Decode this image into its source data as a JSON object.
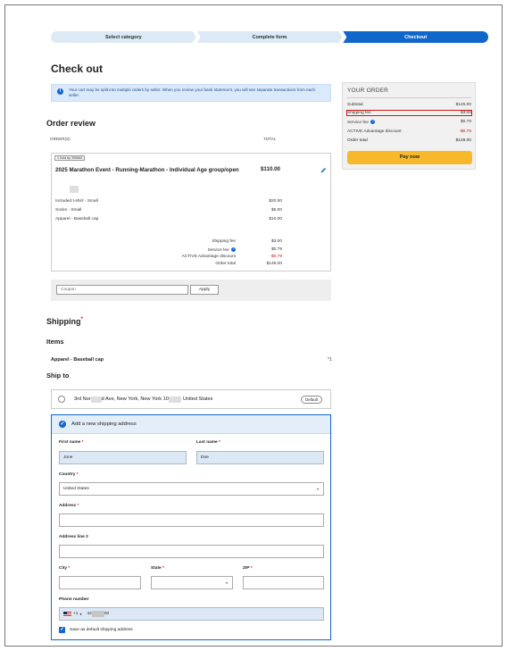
{
  "steps": [
    "Select category",
    "Complete form",
    "Checkout"
  ],
  "page_title": "Check out",
  "info_banner": "Your cart may be split into multiple orders by seller. When you review your bank statement, you will see separate transactions from each seller.",
  "order_review": {
    "title": "Order review",
    "col_orders": "ORDER(S)",
    "col_total": "TOTAL",
    "seller_tag": "1  Sold by 399664",
    "event_title": "2025 Marathon Event - Running-Marathon - Individual Age group/open",
    "event_price": "$110.00",
    "items": [
      {
        "name": "Included t-shirt - Small",
        "price": "$20.00"
      },
      {
        "name": "Socks - Small",
        "price": "$5.00"
      },
      {
        "name": "Apparel - Baseball cap",
        "price": "$10.00"
      }
    ],
    "summary": {
      "shipping_label": "Shipping fee",
      "shipping_value": "$3.00",
      "service_label": "Service fee",
      "service_value": "$0.79",
      "discount_label": "ACTIVE Advantage discount",
      "discount_value": "-$0.79",
      "total_label": "Order total",
      "total_value": "$148.00"
    }
  },
  "coupon": {
    "placeholder": "Coupon",
    "apply_label": "Apply"
  },
  "shipping": {
    "title": "Shipping",
    "required_mark": "*",
    "items_label": "Items",
    "item_name": "Apparel - Baseball cap",
    "item_qty": "*1",
    "ship_to_label": "Ship to",
    "saved_address": {
      "part1": "3rd Nor",
      "part2": "d Ave, New York, New York 10",
      "part3": "United States"
    },
    "default_label": "Default",
    "new_address_title": "Add a new shipping address",
    "form": {
      "first_name_label": "First name",
      "first_name_value": "Jone",
      "last_name_label": "Last name",
      "last_name_value": "Doe",
      "country_label": "Country",
      "country_value": "United States",
      "address_label": "Address",
      "address2_label": "Address line 2",
      "city_label": "City",
      "state_label": "State",
      "zip_label": "ZIP",
      "phone_label": "Phone number",
      "phone_prefix": "+1",
      "phone_part1": "42",
      "phone_part2": "00",
      "req": "*"
    },
    "save_default_label": "Save as default shipping address"
  },
  "your_order": {
    "title": "YOUR ORDER",
    "subtotal_label": "Subtotal",
    "subtotal_value": "$145.00",
    "shipping_label": "Shipping fee",
    "shipping_value": "$3.00",
    "service_label": "Service fee",
    "service_value": "$0.79",
    "discount_label": "ACTIVE Advantage discount",
    "discount_value": "-$0.79",
    "total_label": "Order total",
    "total_value": "$148.00",
    "pay_label": "Pay now"
  },
  "colors": {
    "accent": "#1166cc",
    "pay_button": "#f7b92b",
    "highlight": "#d01818",
    "discount": "#cc1111"
  }
}
